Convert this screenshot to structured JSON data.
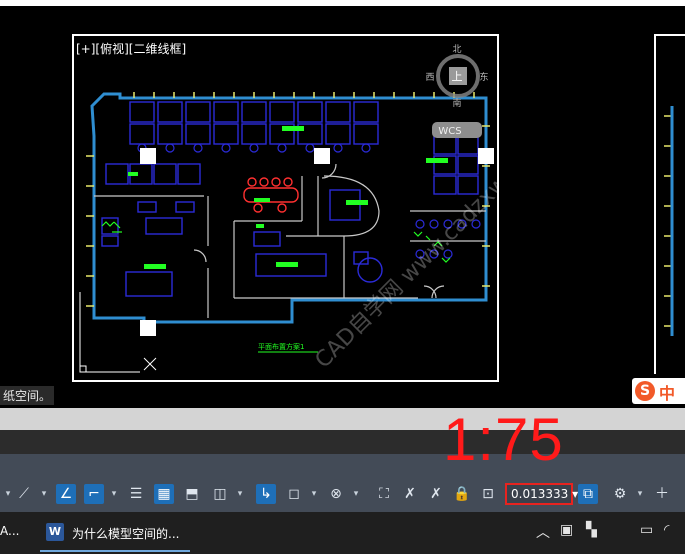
{
  "viewport": {
    "label": "[+][俯视][二维线框]",
    "compass": {
      "north": "北",
      "south": "南",
      "east": "东",
      "west": "西",
      "cube_face": "上"
    },
    "wcs": "WCS",
    "drawing_caption": "平面布置方案1",
    "watermark": "CAD自学网 www.cadzxw.com"
  },
  "paper_space_text": "纸空间。",
  "ime": {
    "logo": "S",
    "text": "中"
  },
  "scale_overlay": "1:75",
  "status_bar": {
    "scale_value": "0.013333"
  },
  "taskbar": {
    "partial_app": "A...",
    "word_label": "为什么模型空间的...",
    "word_icon_letter": "W"
  },
  "colors": {
    "background": "#000000",
    "status_bar": "#434b57",
    "scale_overlay": "#ff1a1a",
    "scale_box_border": "#e8231f",
    "wall": "#2f8ed1",
    "furniture": "#2b2bd8",
    "label_green": "#22ff22",
    "door": "#ffffff"
  }
}
